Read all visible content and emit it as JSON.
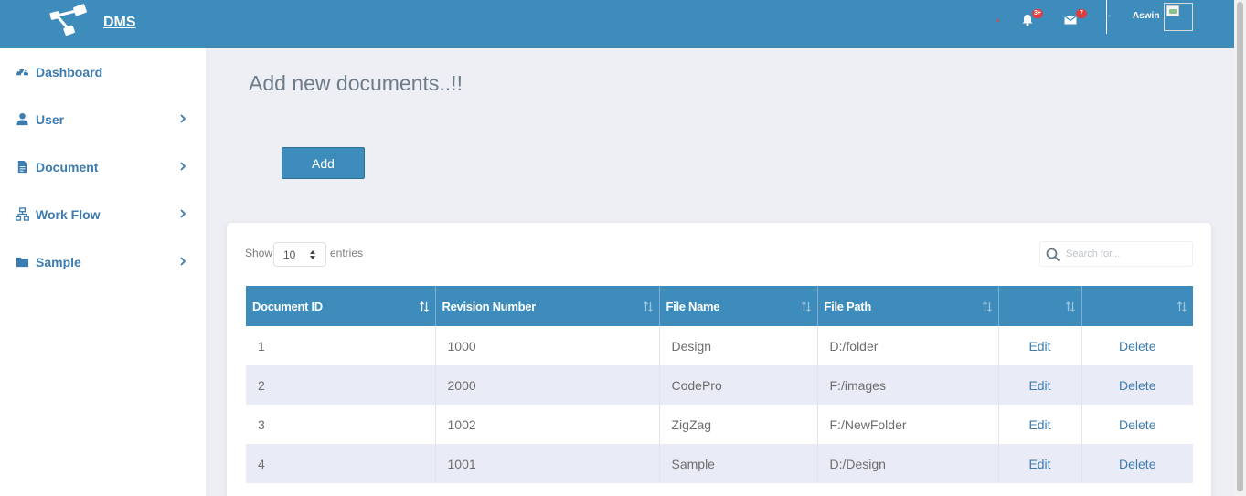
{
  "header": {
    "brand": "DMS",
    "notifications_badge": "3+",
    "messages_badge": "7",
    "username": "Aswin"
  },
  "sidebar": {
    "items": [
      {
        "label": "Dashboard",
        "icon": "tachometer-icon"
      },
      {
        "label": "User",
        "icon": "user-icon"
      },
      {
        "label": "Document",
        "icon": "file-icon"
      },
      {
        "label": "Work Flow",
        "icon": "sitemap-icon"
      },
      {
        "label": "Sample",
        "icon": "folder-icon"
      }
    ]
  },
  "main": {
    "title": "Add new documents..!!",
    "add_label": "Add"
  },
  "table_controls": {
    "show_label": "Show",
    "page_size": "10",
    "entries_label": "entries",
    "search_placeholder": "Search for..."
  },
  "table": {
    "columns": [
      "Document ID",
      "Revision Number",
      "File Name",
      "File Path",
      "",
      ""
    ],
    "rows": [
      {
        "id": "1",
        "revision": "1000",
        "file_name": "Design",
        "file_path": "D:/folder",
        "edit": "Edit",
        "delete": "Delete"
      },
      {
        "id": "2",
        "revision": "2000",
        "file_name": "CodePro",
        "file_path": "F:/images",
        "edit": "Edit",
        "delete": "Delete"
      },
      {
        "id": "3",
        "revision": "1002",
        "file_name": "ZigZag",
        "file_path": "F:/NewFolder",
        "edit": "Edit",
        "delete": "Delete"
      },
      {
        "id": "4",
        "revision": "1001",
        "file_name": "Sample",
        "file_path": "D:/Design",
        "edit": "Edit",
        "delete": "Delete"
      }
    ]
  },
  "colors": {
    "primary": "#3d8cbc",
    "link": "#3d7cb0",
    "background": "#eeeff5",
    "badge": "#e23b3b"
  }
}
